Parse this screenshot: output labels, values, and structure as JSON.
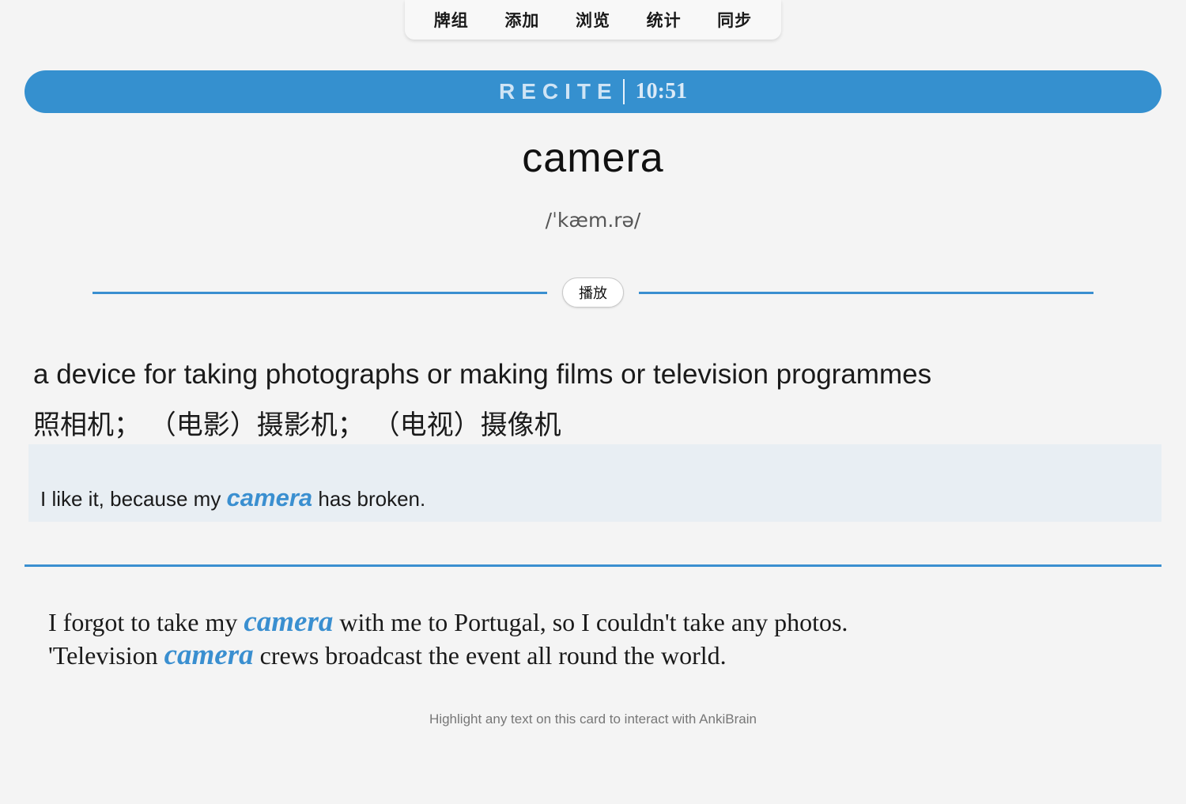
{
  "nav": {
    "items": [
      "牌组",
      "添加",
      "浏览",
      "统计",
      "同步"
    ]
  },
  "recite": {
    "label": "RECITE",
    "timer": "10:51"
  },
  "card": {
    "word": "camera",
    "phonetic": "/ˈkæm.rə/",
    "play_label": "播放",
    "definition_en": "a device for taking photographs or making films or television programmes",
    "definition_zh": "照相机； （电影）摄影机； （电视）摄像机",
    "example": {
      "before": "I like it, because my ",
      "highlight": "camera",
      "after": " has broken."
    },
    "more_examples": [
      {
        "before": "I forgot to take my ",
        "highlight": "camera",
        "after": " with me to Portugal, so I couldn't take any photos."
      },
      {
        "before": "'Television ",
        "highlight": "camera",
        "after": " crews broadcast the event all round the world."
      }
    ]
  },
  "footer": {
    "hint": "Highlight any text on this card to interact with AnkiBrain"
  },
  "colors": {
    "accent": "#3a8fd0",
    "recite_bar": "#3590cf",
    "example_bg": "#e8eef3",
    "page_bg": "#f4f4f4"
  }
}
